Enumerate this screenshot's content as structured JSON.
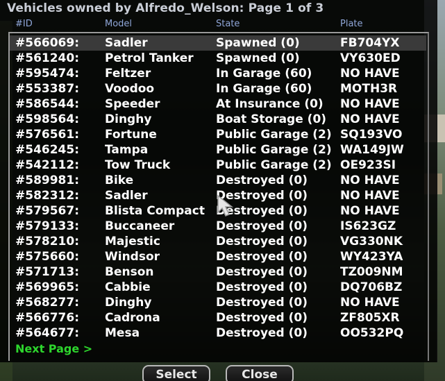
{
  "dialog": {
    "title": "Vehicles owned by Alfredo_Welson: Page 1 of 3",
    "columns": [
      "#ID",
      "Model",
      "State",
      "Plate"
    ],
    "rows": [
      [
        "#566069:",
        "Sadler",
        "Spawned (0)",
        "FB704YX"
      ],
      [
        "#561240:",
        "Petrol Tanker",
        "Spawned (0)",
        "VY630ED"
      ],
      [
        "#595474:",
        "Feltzer",
        "In Garage (60)",
        "NO HAVE"
      ],
      [
        "#553387:",
        "Voodoo",
        "In Garage (60)",
        "MOTH3R"
      ],
      [
        "#586544:",
        "Speeder",
        "At Insurance (0)",
        "NO HAVE"
      ],
      [
        "#598564:",
        "Dinghy",
        "Boat Storage (0)",
        "NO HAVE"
      ],
      [
        "#576561:",
        "Fortune",
        "Public Garage (2)",
        "SQ193VO"
      ],
      [
        "#546245:",
        "Tampa",
        "Public Garage (2)",
        "WA149JW"
      ],
      [
        "#542112:",
        "Tow Truck",
        "Public Garage (2)",
        "OE923SI"
      ],
      [
        "#589981:",
        "Bike",
        "Destroyed (0)",
        "NO HAVE"
      ],
      [
        "#582312:",
        "Sadler",
        "Destroyed (0)",
        "NO HAVE"
      ],
      [
        "#579567:",
        "Blista Compact",
        "Destroyed (0)",
        "NO HAVE"
      ],
      [
        "#579133:",
        "Buccaneer",
        "Destroyed (0)",
        "IS623GZ"
      ],
      [
        "#578210:",
        "Majestic",
        "Destroyed (0)",
        "VG330NK"
      ],
      [
        "#575660:",
        "Windsor",
        "Destroyed (0)",
        "WY423YA"
      ],
      [
        "#571713:",
        "Benson",
        "Destroyed (0)",
        "TZ009NM"
      ],
      [
        "#569965:",
        "Cabbie",
        "Destroyed (0)",
        "DQ706BZ"
      ],
      [
        "#568277:",
        "Dinghy",
        "Destroyed (0)",
        "NO HAVE"
      ],
      [
        "#566776:",
        "Cadrona",
        "Destroyed (0)",
        "ZF805XR"
      ],
      [
        "#564677:",
        "Mesa",
        "Destroyed (0)",
        "OO532PQ"
      ]
    ],
    "next_page_label": "Next Page >",
    "select_label": "Select",
    "close_label": "Close",
    "selected_row_index": 0
  },
  "colors": {
    "title": "#c9cdd6",
    "header": "#8fa6d8",
    "row_text": "#ffffff",
    "next_page": "#2dd62d",
    "selection": "#3a3a3a"
  },
  "icons": {
    "cursor": "mouse-pointer-icon"
  }
}
